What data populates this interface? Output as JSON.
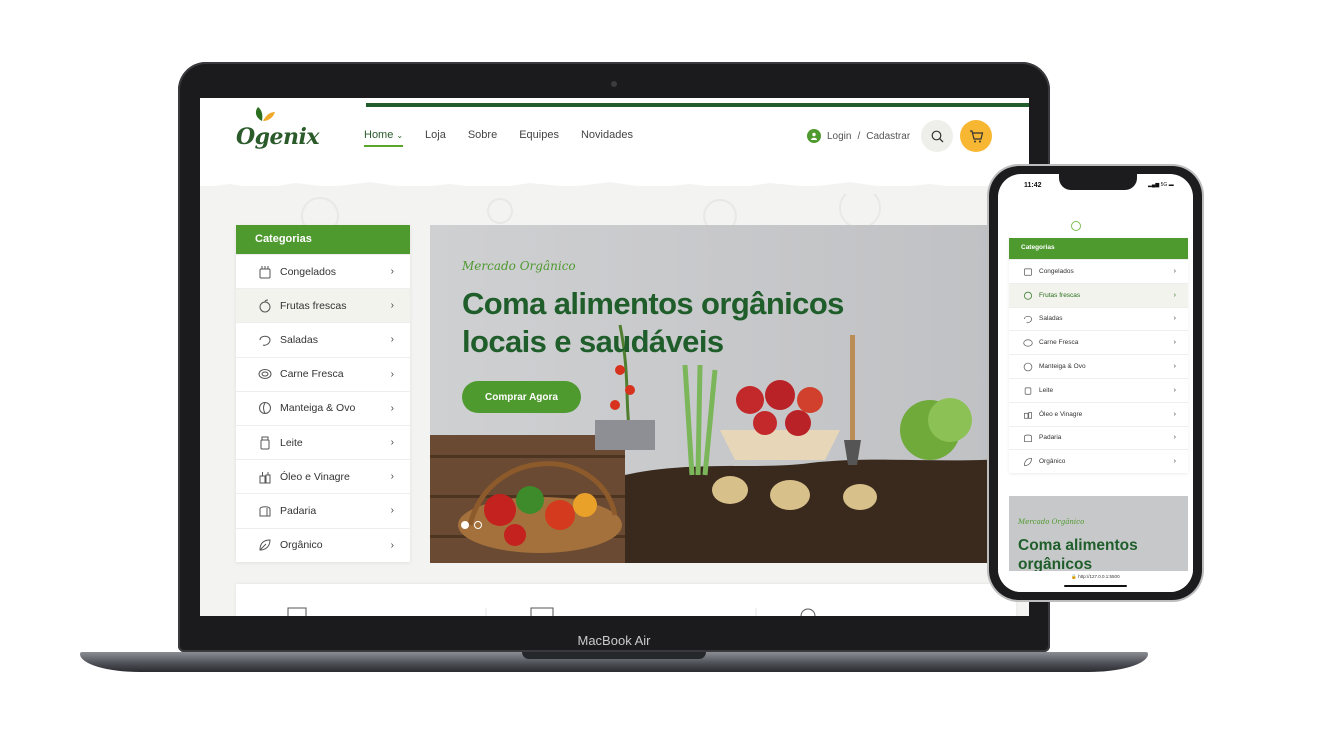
{
  "site": {
    "logo_text": "Ogenix",
    "nav": [
      {
        "label": "Home",
        "active": true
      },
      {
        "label": "Loja"
      },
      {
        "label": "Sobre"
      },
      {
        "label": "Equipes"
      },
      {
        "label": "Novidades"
      }
    ],
    "login_label": "Login",
    "login_sep": "/",
    "register_label": "Cadastrar",
    "categories_title": "Categorias",
    "categories": [
      {
        "label": "Congelados",
        "icon": "frozen-icon"
      },
      {
        "label": "Frutas frescas",
        "icon": "fruit-icon",
        "selected": true
      },
      {
        "label": "Saladas",
        "icon": "salad-icon"
      },
      {
        "label": "Carne Fresca",
        "icon": "meat-icon"
      },
      {
        "label": "Manteiga & Ovo",
        "icon": "egg-icon"
      },
      {
        "label": "Leite",
        "icon": "milk-icon"
      },
      {
        "label": "Óleo e Vinagre",
        "icon": "oil-icon"
      },
      {
        "label": "Padaria",
        "icon": "bread-icon"
      },
      {
        "label": "Orgânico",
        "icon": "leaf-icon"
      }
    ],
    "hero": {
      "subtitle": "Mercado Orgânico",
      "title": "Coma alimentos orgânicos locais e saudáveis",
      "button": "Comprar Agora"
    }
  },
  "device": {
    "laptop_label": "MacBook Air"
  },
  "phone": {
    "time": "11:42",
    "status": "5G",
    "categories_title": "Categorias",
    "categories": [
      {
        "label": "Congelados"
      },
      {
        "label": "Frutas frescas",
        "selected": true
      },
      {
        "label": "Saladas"
      },
      {
        "label": "Carne Fresca"
      },
      {
        "label": "Manteiga & Ovo"
      },
      {
        "label": "Leite"
      },
      {
        "label": "Óleo e Vinagre"
      },
      {
        "label": "Padaria"
      },
      {
        "label": "Orgânico"
      }
    ],
    "hero_subtitle": "Mercado Orgânico",
    "hero_title": "Coma alimentos orgânicos",
    "url": "http://127.0.0.1:5500"
  },
  "colors": {
    "brand_green": "#4f9a2f",
    "dark_green": "#1f5e2b",
    "cart_yellow": "#f7b733"
  }
}
